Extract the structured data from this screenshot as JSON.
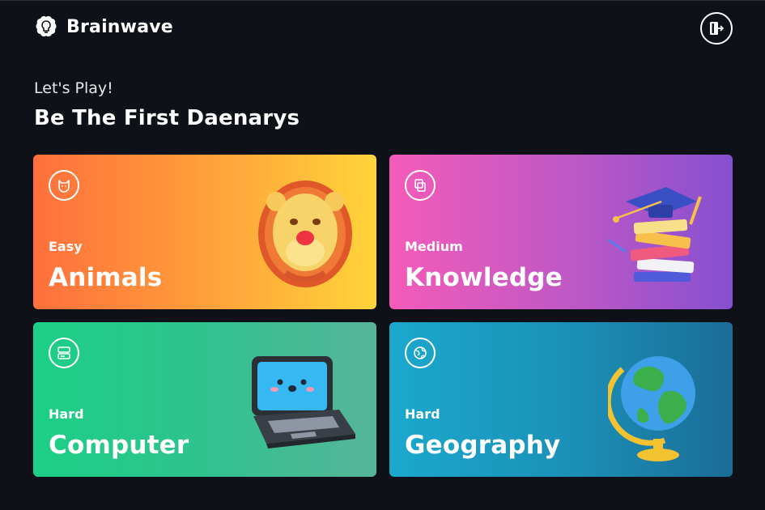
{
  "header": {
    "app_name": "Brainwave",
    "logo_icon": "brain-bulb-icon",
    "logout_icon": "logout-door-icon"
  },
  "hero": {
    "greeting": "Let's Play!",
    "headline": "Be The First Daenarys"
  },
  "categories": [
    {
      "difficulty": "Easy",
      "title": "Animals",
      "icon": "cat-icon",
      "illustration": "lion-illustration",
      "colors": [
        "#ff6f3c",
        "#ffd43a"
      ]
    },
    {
      "difficulty": "Medium",
      "title": "Knowledge",
      "icon": "copy-icon",
      "illustration": "books-illustration",
      "colors": [
        "#f45bb8",
        "#8650d0"
      ]
    },
    {
      "difficulty": "Hard",
      "title": "Computer",
      "icon": "server-icon",
      "illustration": "laptop-illustration",
      "colors": [
        "#1ccf86",
        "#57b599"
      ]
    },
    {
      "difficulty": "Hard",
      "title": "Geography",
      "icon": "globe-icon",
      "illustration": "globe-illustration",
      "colors": [
        "#1ba8cd",
        "#1b6c96"
      ]
    }
  ]
}
